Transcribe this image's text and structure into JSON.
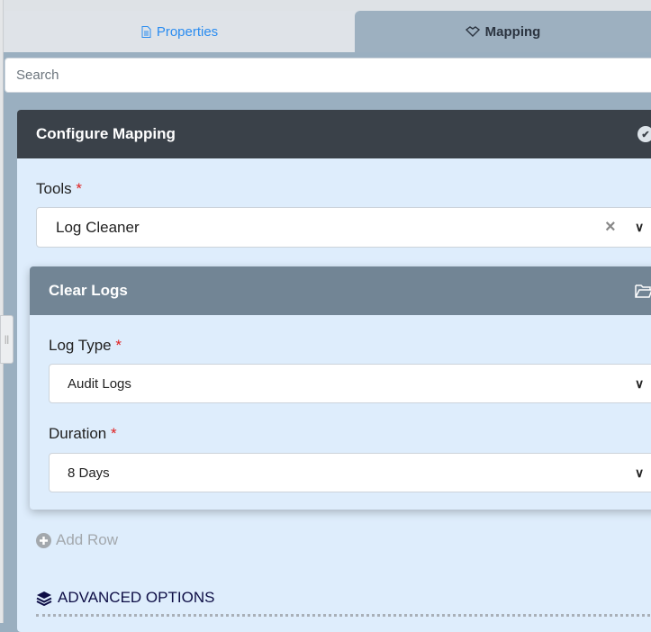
{
  "tabs": [
    {
      "label": "Properties",
      "icon": "document-icon",
      "active": false
    },
    {
      "label": "Mapping",
      "icon": "handshake-icon",
      "active": true
    }
  ],
  "search": {
    "placeholder": "Search",
    "value": ""
  },
  "configure": {
    "title": "Configure Mapping",
    "tools": {
      "label": "Tools",
      "required": "*",
      "value": "Log Cleaner",
      "clear": "×",
      "chevron": "⌄"
    }
  },
  "clear_logs": {
    "title": "Clear Logs",
    "log_type": {
      "label": "Log Type",
      "required": "*",
      "value": "Audit Logs"
    },
    "duration": {
      "label": "Duration",
      "required": "*",
      "value": "8 Days"
    }
  },
  "add_row": "Add Row",
  "advanced": "ADVANCED OPTIONS",
  "colors": {
    "accent": "#2a8cf0",
    "header_dark": "#3a4149",
    "subheader": "#728595",
    "body": "#deedfc"
  }
}
